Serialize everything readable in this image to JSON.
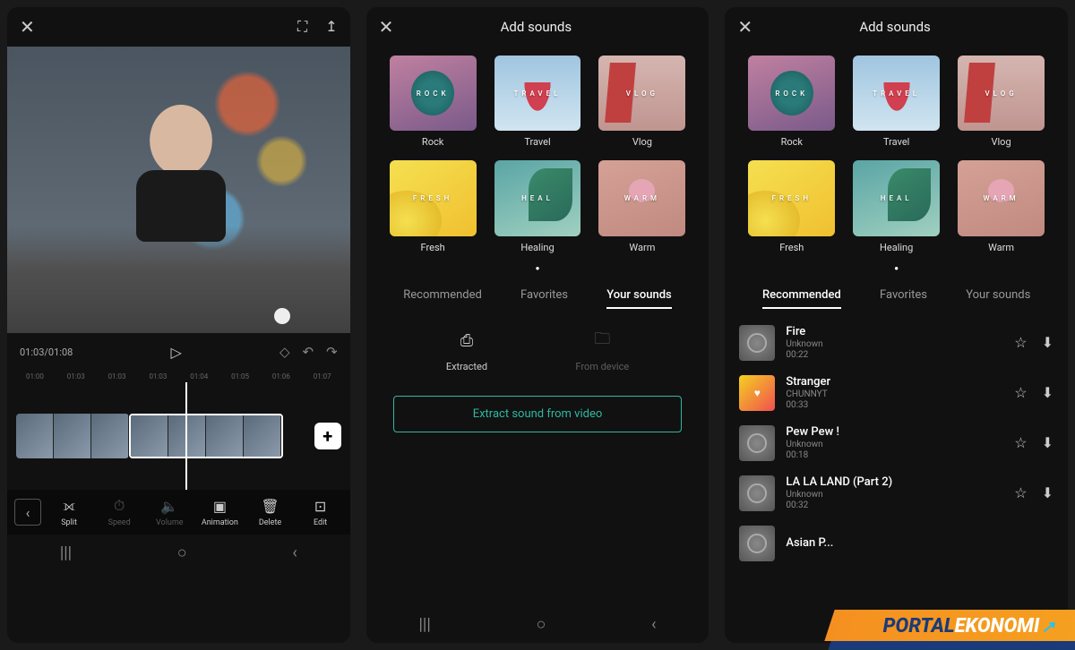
{
  "editor": {
    "time_display": "01:03/01:08",
    "ruler": [
      "01:00",
      "01:03",
      "01:03",
      "01:03",
      "01:04",
      "01:05",
      "01:06",
      "01:07"
    ],
    "tools": [
      {
        "label": "Split"
      },
      {
        "label": "Speed"
      },
      {
        "label": "Volume"
      },
      {
        "label": "Animation"
      },
      {
        "label": "Delete"
      },
      {
        "label": "Edit"
      }
    ]
  },
  "sounds": {
    "header_title": "Add sounds",
    "categories": [
      {
        "label": "Rock",
        "tag": "ROCK"
      },
      {
        "label": "Travel",
        "tag": "TRAVEL"
      },
      {
        "label": "Vlog",
        "tag": "VLOG"
      },
      {
        "label": "Fresh",
        "tag": "FRESH"
      },
      {
        "label": "Healing",
        "tag": "HEAL"
      },
      {
        "label": "Warm",
        "tag": "WARM"
      }
    ],
    "tabs": {
      "recommended": "Recommended",
      "favorites": "Favorites",
      "your_sounds": "Your sounds"
    },
    "sources": {
      "extracted": "Extracted",
      "from_device": "From device"
    },
    "extract_button": "Extract sound from video",
    "tracks": [
      {
        "title": "Fire",
        "artist": "Unknown",
        "duration": "00:22"
      },
      {
        "title": "Stranger",
        "artist": "CHUNNYT",
        "duration": "00:33"
      },
      {
        "title": "Pew Pew !",
        "artist": "Unknown",
        "duration": "00:18"
      },
      {
        "title": "LA LA LAND (Part 2)",
        "artist": "Unknown",
        "duration": "00:32"
      },
      {
        "title": "Asian P...",
        "artist": "",
        "duration": ""
      }
    ]
  },
  "watermark": {
    "part1": "PORTAL",
    "part2": "EKONOMI"
  }
}
